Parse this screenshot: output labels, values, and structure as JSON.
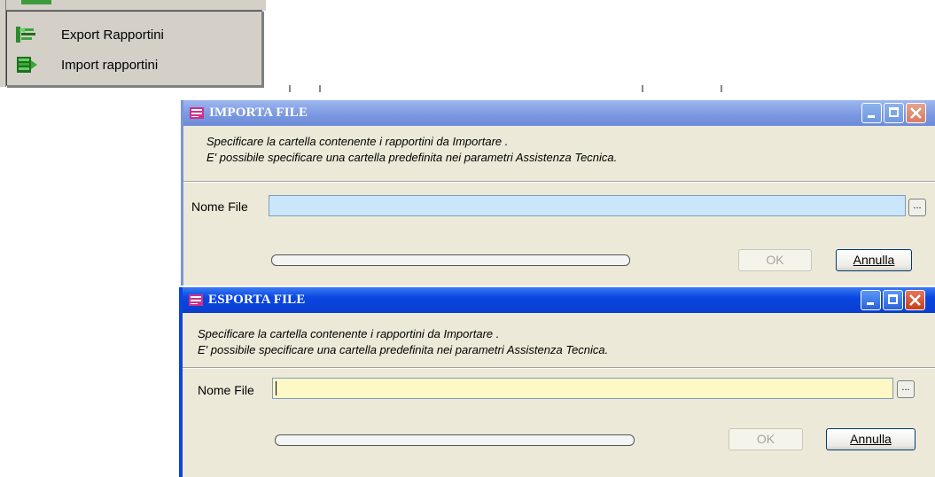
{
  "menu": {
    "items": [
      {
        "label": "Export Rapportini",
        "icon": "export-icon"
      },
      {
        "label": "Import rapportini",
        "icon": "import-icon"
      }
    ]
  },
  "import_dialog": {
    "title": "IMPORTA FILE",
    "message_line1": "Specificare la cartella contenente i  rapportini da Importare .",
    "message_line2": "E' possibile specificare una cartella predefinita nei parametri Assistenza Tecnica.",
    "field_label": "Nome File",
    "field_value": "",
    "browse_label": "...",
    "ok_label": "OK",
    "cancel_label": "Annulla",
    "field_color": "#c9e6fb"
  },
  "export_dialog": {
    "title": "ESPORTA FILE",
    "message_line1": "Specificare la cartella contenente i  rapportini da Importare .",
    "message_line2": "E' possibile specificare una cartella predefinita nei parametri Assistenza Tecnica.",
    "field_label": "Nome File",
    "field_value": "",
    "browse_label": "...",
    "ok_label": "OK",
    "cancel_label": "Annulla",
    "field_color": "#fdf8c6"
  },
  "colors": {
    "active_titlebar": "#0a46e0",
    "inactive_titlebar": "#7a96df",
    "dialog_bg": "#ece9d8"
  }
}
